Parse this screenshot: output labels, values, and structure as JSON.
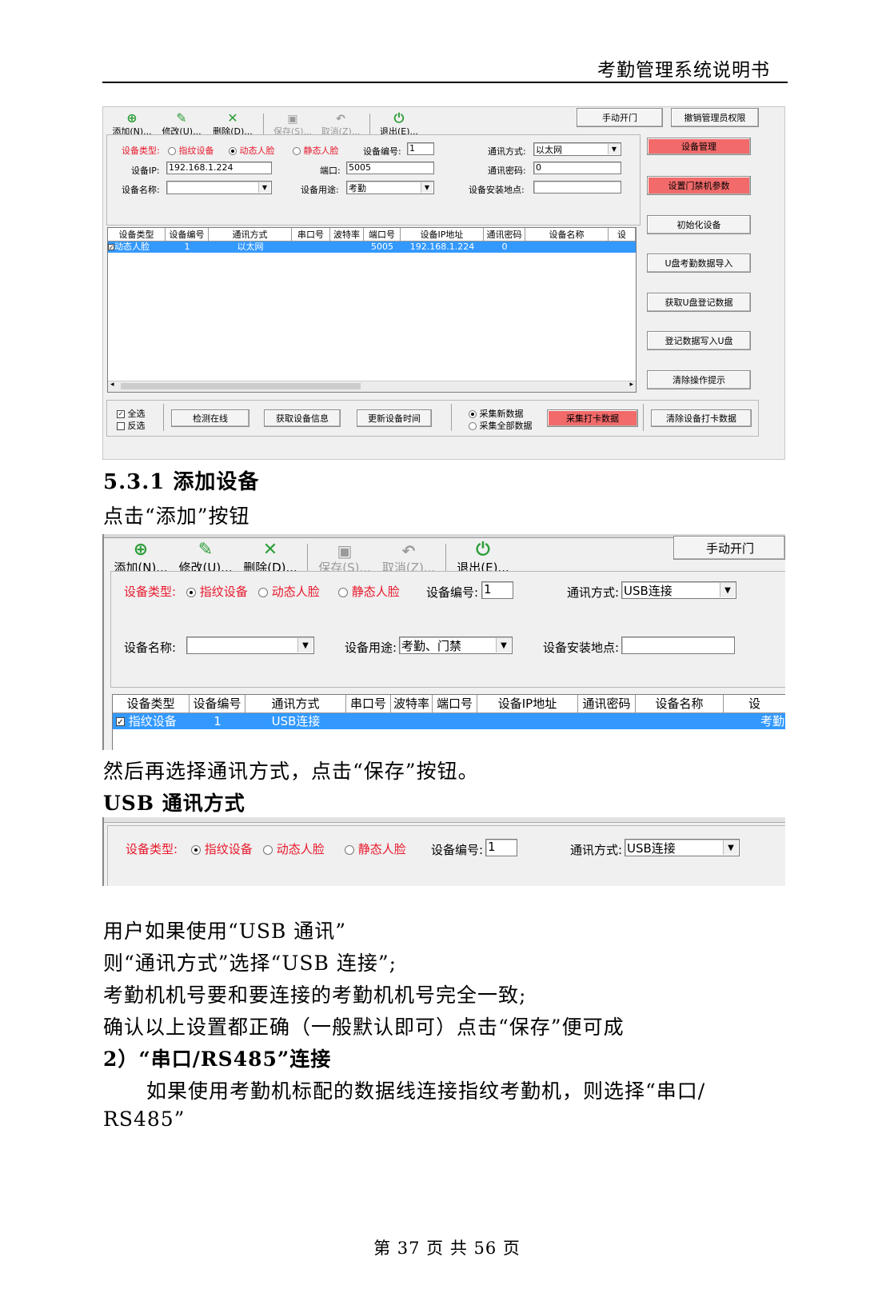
{
  "header": {
    "title": "考勤管理系统说明书"
  },
  "toolbar": {
    "add": "添加(N)...",
    "edit": "修改(U)...",
    "delete": "删除(D)...",
    "save": "保存(S)...",
    "cancel": "取消(Z)...",
    "exit": "退出(E)...",
    "manual_open": "手动开门",
    "revoke_admin": "撤销管理员权限"
  },
  "form1": {
    "device_type_label": "设备类型:",
    "opt_fingerprint": "指纹设备",
    "opt_dynamic_face": "动态人脸",
    "opt_static_face": "静态人脸",
    "selected_type": "动态人脸",
    "device_no_label": "设备编号:",
    "device_no": "1",
    "comm_label": "通讯方式:",
    "comm_value": "以太网",
    "ip_label": "设备IP:",
    "ip_value": "192.168.1.224",
    "port_label": "端口:",
    "port_value": "5005",
    "pwd_label": "通讯密码:",
    "pwd_value": "0",
    "name_label": "设备名称:",
    "name_value": "",
    "usage_label": "设备用途:",
    "usage_value": "考勤",
    "location_label": "设备安装地点:",
    "location_value": ""
  },
  "side_buttons": [
    "设备管理",
    "设置门禁机参数",
    "初始化设备",
    "U盘考勤数据导入",
    "获取U盘登记数据",
    "登记数据写入U盘",
    "清除操作提示"
  ],
  "table": {
    "headers": [
      "设备类型",
      "设备编号",
      "通讯方式",
      "串口号",
      "波特率",
      "端口号",
      "设备IP地址",
      "通讯密码",
      "设备名称",
      "设"
    ],
    "row1": [
      "动态人脸",
      "1",
      "以太网",
      "",
      "",
      "5005",
      "192.168.1.224",
      "0",
      "",
      ""
    ]
  },
  "bottom_bar": {
    "select_all": "全选",
    "invert": "反选",
    "check_online": "检测在线",
    "get_info": "获取设备信息",
    "update_time": "更新设备时间",
    "collect_new": "采集新数据",
    "collect_all": "采集全部数据",
    "collect_punch": "采集打卡数据",
    "clear_punch": "清除设备打卡数据"
  },
  "section": {
    "heading": "5.3.1  添加设备",
    "click_add": "点击“添加”按钮"
  },
  "form2": {
    "selected_type": "指纹设备",
    "comm_value": "USB连接",
    "usage_value": "考勤、门禁",
    "row_type": "指纹设备",
    "row_no": "1",
    "row_comm": "USB连接",
    "row_tail": "考勤"
  },
  "text": {
    "after_select": "然后再选择通讯方式，点击“保存”按钮。",
    "usb_heading": "USB 通讯方式",
    "p1": "用户如果使用“USB 通讯”",
    "p2": "则“通讯方式”选择“USB 连接”;",
    "p3": "考勤机机号要和要连接的考勤机机号完全一致;",
    "p4": "确认以上设置都正确（一般默认即可）点击“保存”便可成",
    "serial_heading": "2）“串口/RS485”连接",
    "p5a": "如果使用考勤机标配的数据线连接指纹考勤机，则选择“串口/",
    "p5b": "RS485”"
  },
  "footer": {
    "page": "第 37 页 共 56 页"
  }
}
